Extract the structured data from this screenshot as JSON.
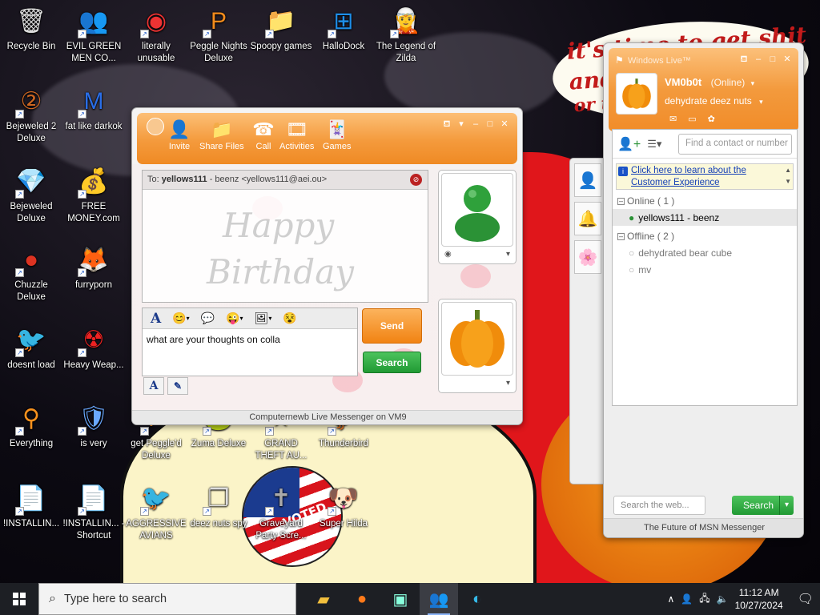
{
  "wallpaper": {
    "note_lines": [
      "it's time to get shit",
      "and",
      "or t"
    ],
    "badge": "VOTED"
  },
  "desktop_icons": [
    {
      "label": "Recycle Bin",
      "icon": "recycle-bin-icon"
    },
    {
      "label": "EVIL GREEN MEN CO...",
      "icon": "msn-people-icon"
    },
    {
      "label": "literally unusable",
      "icon": "chrome-icon"
    },
    {
      "label": "Peggle Nights Deluxe",
      "icon": "peggle-icon"
    },
    {
      "label": "Spoopy games",
      "icon": "folder-icon"
    },
    {
      "label": "HalloDock",
      "icon": "windows-logo-icon"
    },
    {
      "label": "The Legend of Zilda",
      "icon": "zelda-icon"
    },
    {
      "label": "Bejeweled 2 Deluxe",
      "icon": "bejeweled2-icon"
    },
    {
      "label": "fat like darkok",
      "icon": "mpl-icon"
    },
    {
      "label": "Bejeweled Deluxe",
      "icon": "diamond-icon"
    },
    {
      "label": "FREE MONEY.com",
      "icon": "money-bag-icon"
    },
    {
      "label": "Chuzzle Deluxe",
      "icon": "chuzzle-icon"
    },
    {
      "label": "furryporn",
      "icon": "firefox-icon"
    },
    {
      "label": "doesnt load",
      "icon": "thunderbird-icon"
    },
    {
      "label": "Heavy Weap...",
      "icon": "radiation-icon"
    },
    {
      "label": "Everything",
      "icon": "magnifier-icon"
    },
    {
      "label": "is very",
      "icon": "shield-mpl-icon"
    },
    {
      "label": "get Peggle'd Deluxe",
      "icon": "peggle-icon"
    },
    {
      "label": "Zuma Deluxe",
      "icon": "zuma-icon"
    },
    {
      "label": "GRAND THEFT AU...",
      "icon": "gta-icon"
    },
    {
      "label": "Thunderbird",
      "icon": "thunderbird-icon"
    },
    {
      "label": "!INSTALLIN...",
      "icon": "document-icon"
    },
    {
      "label": "!INSTALLIN... - Shortcut",
      "icon": "document-icon"
    },
    {
      "label": "AGGRESSIVE AVIANS",
      "icon": "angry-bird-icon"
    },
    {
      "label": "deez nuts spy",
      "icon": "windows-stack-icon"
    },
    {
      "label": "Graveyard Party Scre...",
      "icon": "grave-icon"
    },
    {
      "label": "Super Hilda",
      "icon": "pixel-dog-icon"
    },
    {
      "label": "P",
      "icon": "partial-icon"
    }
  ],
  "conversation": {
    "toolbar": [
      {
        "label": "Invite",
        "icon": "invite-icon"
      },
      {
        "label": "Share Files",
        "icon": "folder-icon"
      },
      {
        "label": "Call",
        "icon": "phone-icon"
      },
      {
        "label": "Activities",
        "icon": "activities-icon"
      },
      {
        "label": "Games",
        "icon": "games-icon"
      }
    ],
    "to_prefix": "To:",
    "to_name": "yellows111",
    "to_detail": "- beenz <yellows111@aei.ou>",
    "background_text": [
      "Happy",
      "Birthday"
    ],
    "input_text": "what are your thoughts on colla",
    "send_label": "Send",
    "search_label": "Search",
    "status_bar": "Computernewb Live Messenger on VM9"
  },
  "contact_list": {
    "title": "Windows Live™",
    "display_name": "VM0b0t",
    "status": "(Online)",
    "personal_message": "dehydrate deez nuts",
    "find_placeholder": "Find a contact or number",
    "ad_text": "Click here to learn about the Customer Experience",
    "groups": [
      {
        "name": "Online ( 1 )",
        "contacts": [
          {
            "name": "yellows111 - beenz",
            "status": "online"
          }
        ]
      },
      {
        "name": "Offline ( 2 )",
        "contacts": [
          {
            "name": "dehydrated bear cube",
            "status": "offline"
          },
          {
            "name": "mv",
            "status": "offline"
          }
        ]
      }
    ],
    "web_search_placeholder": "Search the web...",
    "web_search_button": "Search",
    "footer": "The Future of MSN Messenger"
  },
  "taskbar": {
    "search_placeholder": "Type here to search",
    "time": "11:12 AM",
    "date": "10/27/2024"
  },
  "colors": {
    "msn_orange": "#f39a3d",
    "msn_green": "#219a34",
    "taskbar": "#1d1f24"
  }
}
